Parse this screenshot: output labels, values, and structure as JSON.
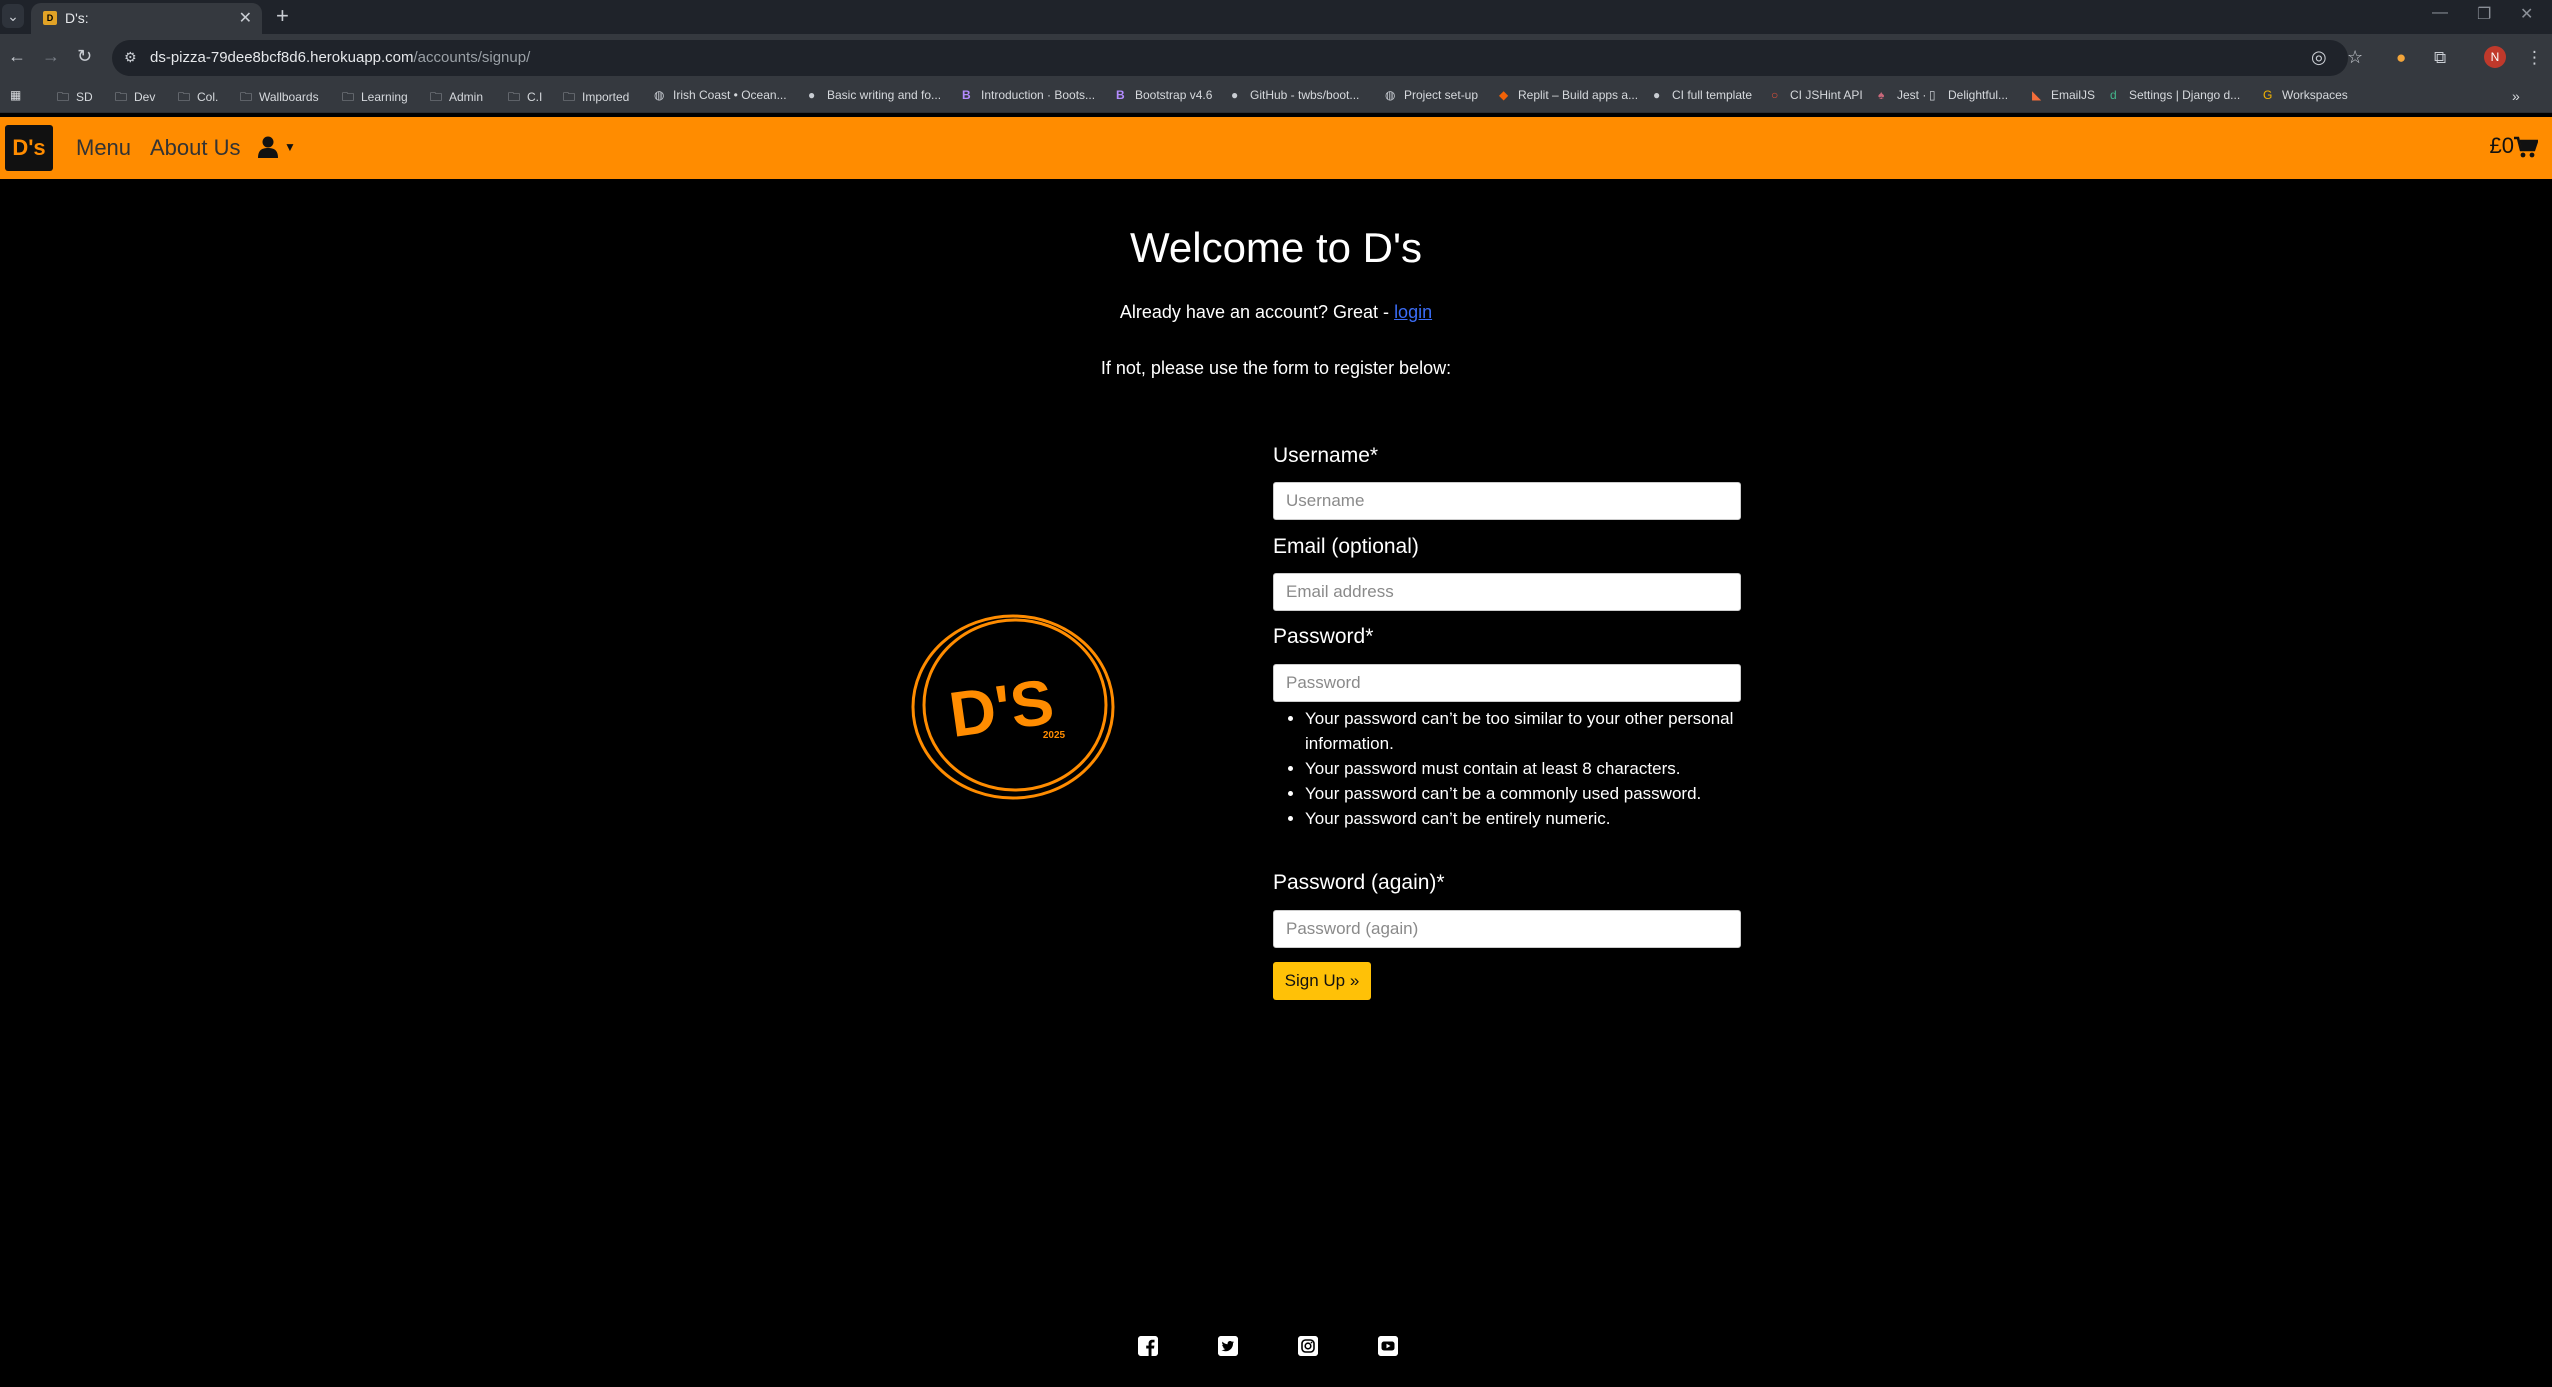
{
  "browser": {
    "tab_title": "D's:",
    "url_host": "ds-pizza-79dee8bcf8d6.herokuapp.com",
    "url_path": "/accounts/signup/",
    "profile_initial": "N",
    "bookmarks": [
      {
        "label": "SD",
        "icon": "folder-icon"
      },
      {
        "label": "Dev",
        "icon": "folder-icon"
      },
      {
        "label": "Col.",
        "icon": "folder-icon"
      },
      {
        "label": "Wallboards",
        "icon": "folder-icon"
      },
      {
        "label": "Learning",
        "icon": "folder-icon"
      },
      {
        "label": "Admin",
        "icon": "folder-icon"
      },
      {
        "label": "C.I",
        "icon": "folder-icon"
      },
      {
        "label": "Imported",
        "icon": "folder-icon"
      },
      {
        "label": "Irish Coast • Ocean...",
        "icon": "globe-icon"
      },
      {
        "label": "Basic writing and fo...",
        "icon": "github-icon"
      },
      {
        "label": "Introduction · Boots...",
        "icon": "bootstrap-icon"
      },
      {
        "label": "Bootstrap v4.6",
        "icon": "bootstrap-icon"
      },
      {
        "label": "GitHub - twbs/boot...",
        "icon": "github-icon"
      },
      {
        "label": "Project set-up",
        "icon": "globe-icon"
      },
      {
        "label": "Replit – Build apps a...",
        "icon": "replit-icon"
      },
      {
        "label": "CI full template",
        "icon": "github-icon"
      },
      {
        "label": "CI JSHint API",
        "icon": "circle-icon"
      },
      {
        "label": "Jest ·",
        "icon": "jest-icon"
      },
      {
        "label": "Delightful...",
        "icon": "page-icon"
      },
      {
        "label": "EmailJS",
        "icon": "emailjs-icon"
      },
      {
        "label": "Settings | Django d...",
        "icon": "django-icon"
      },
      {
        "label": "Workspaces",
        "icon": "workspaces-icon"
      }
    ]
  },
  "navbar": {
    "brand": "D's",
    "menu_label": "Menu",
    "about_label": "About Us",
    "cart_total": "£0"
  },
  "main": {
    "heading": "Welcome to D's",
    "login_prompt": "Already have an account? Great - ",
    "login_link": "login",
    "register_prompt": "If not, please use the form to register below:",
    "logo_text": "D'S",
    "logo_year": "2025"
  },
  "form": {
    "username_label": "Username*",
    "username_placeholder": "Username",
    "email_label": "Email (optional)",
    "email_placeholder": "Email address",
    "password_label": "Password*",
    "password_placeholder": "Password",
    "password_help": [
      "Your password can’t be too similar to your other personal information.",
      "Your password must contain at least 8 characters.",
      "Your password can’t be a commonly used password.",
      "Your password can’t be entirely numeric."
    ],
    "password2_label": "Password (again)*",
    "password2_placeholder": "Password (again)",
    "submit_label": "Sign Up »"
  },
  "footer": {
    "icons": [
      "facebook-icon",
      "twitter-icon",
      "instagram-icon",
      "youtube-icon"
    ]
  },
  "colors": {
    "brand_orange": "#ff8c00",
    "button_yellow": "#ffc107",
    "link_blue": "#3b6cf5"
  }
}
